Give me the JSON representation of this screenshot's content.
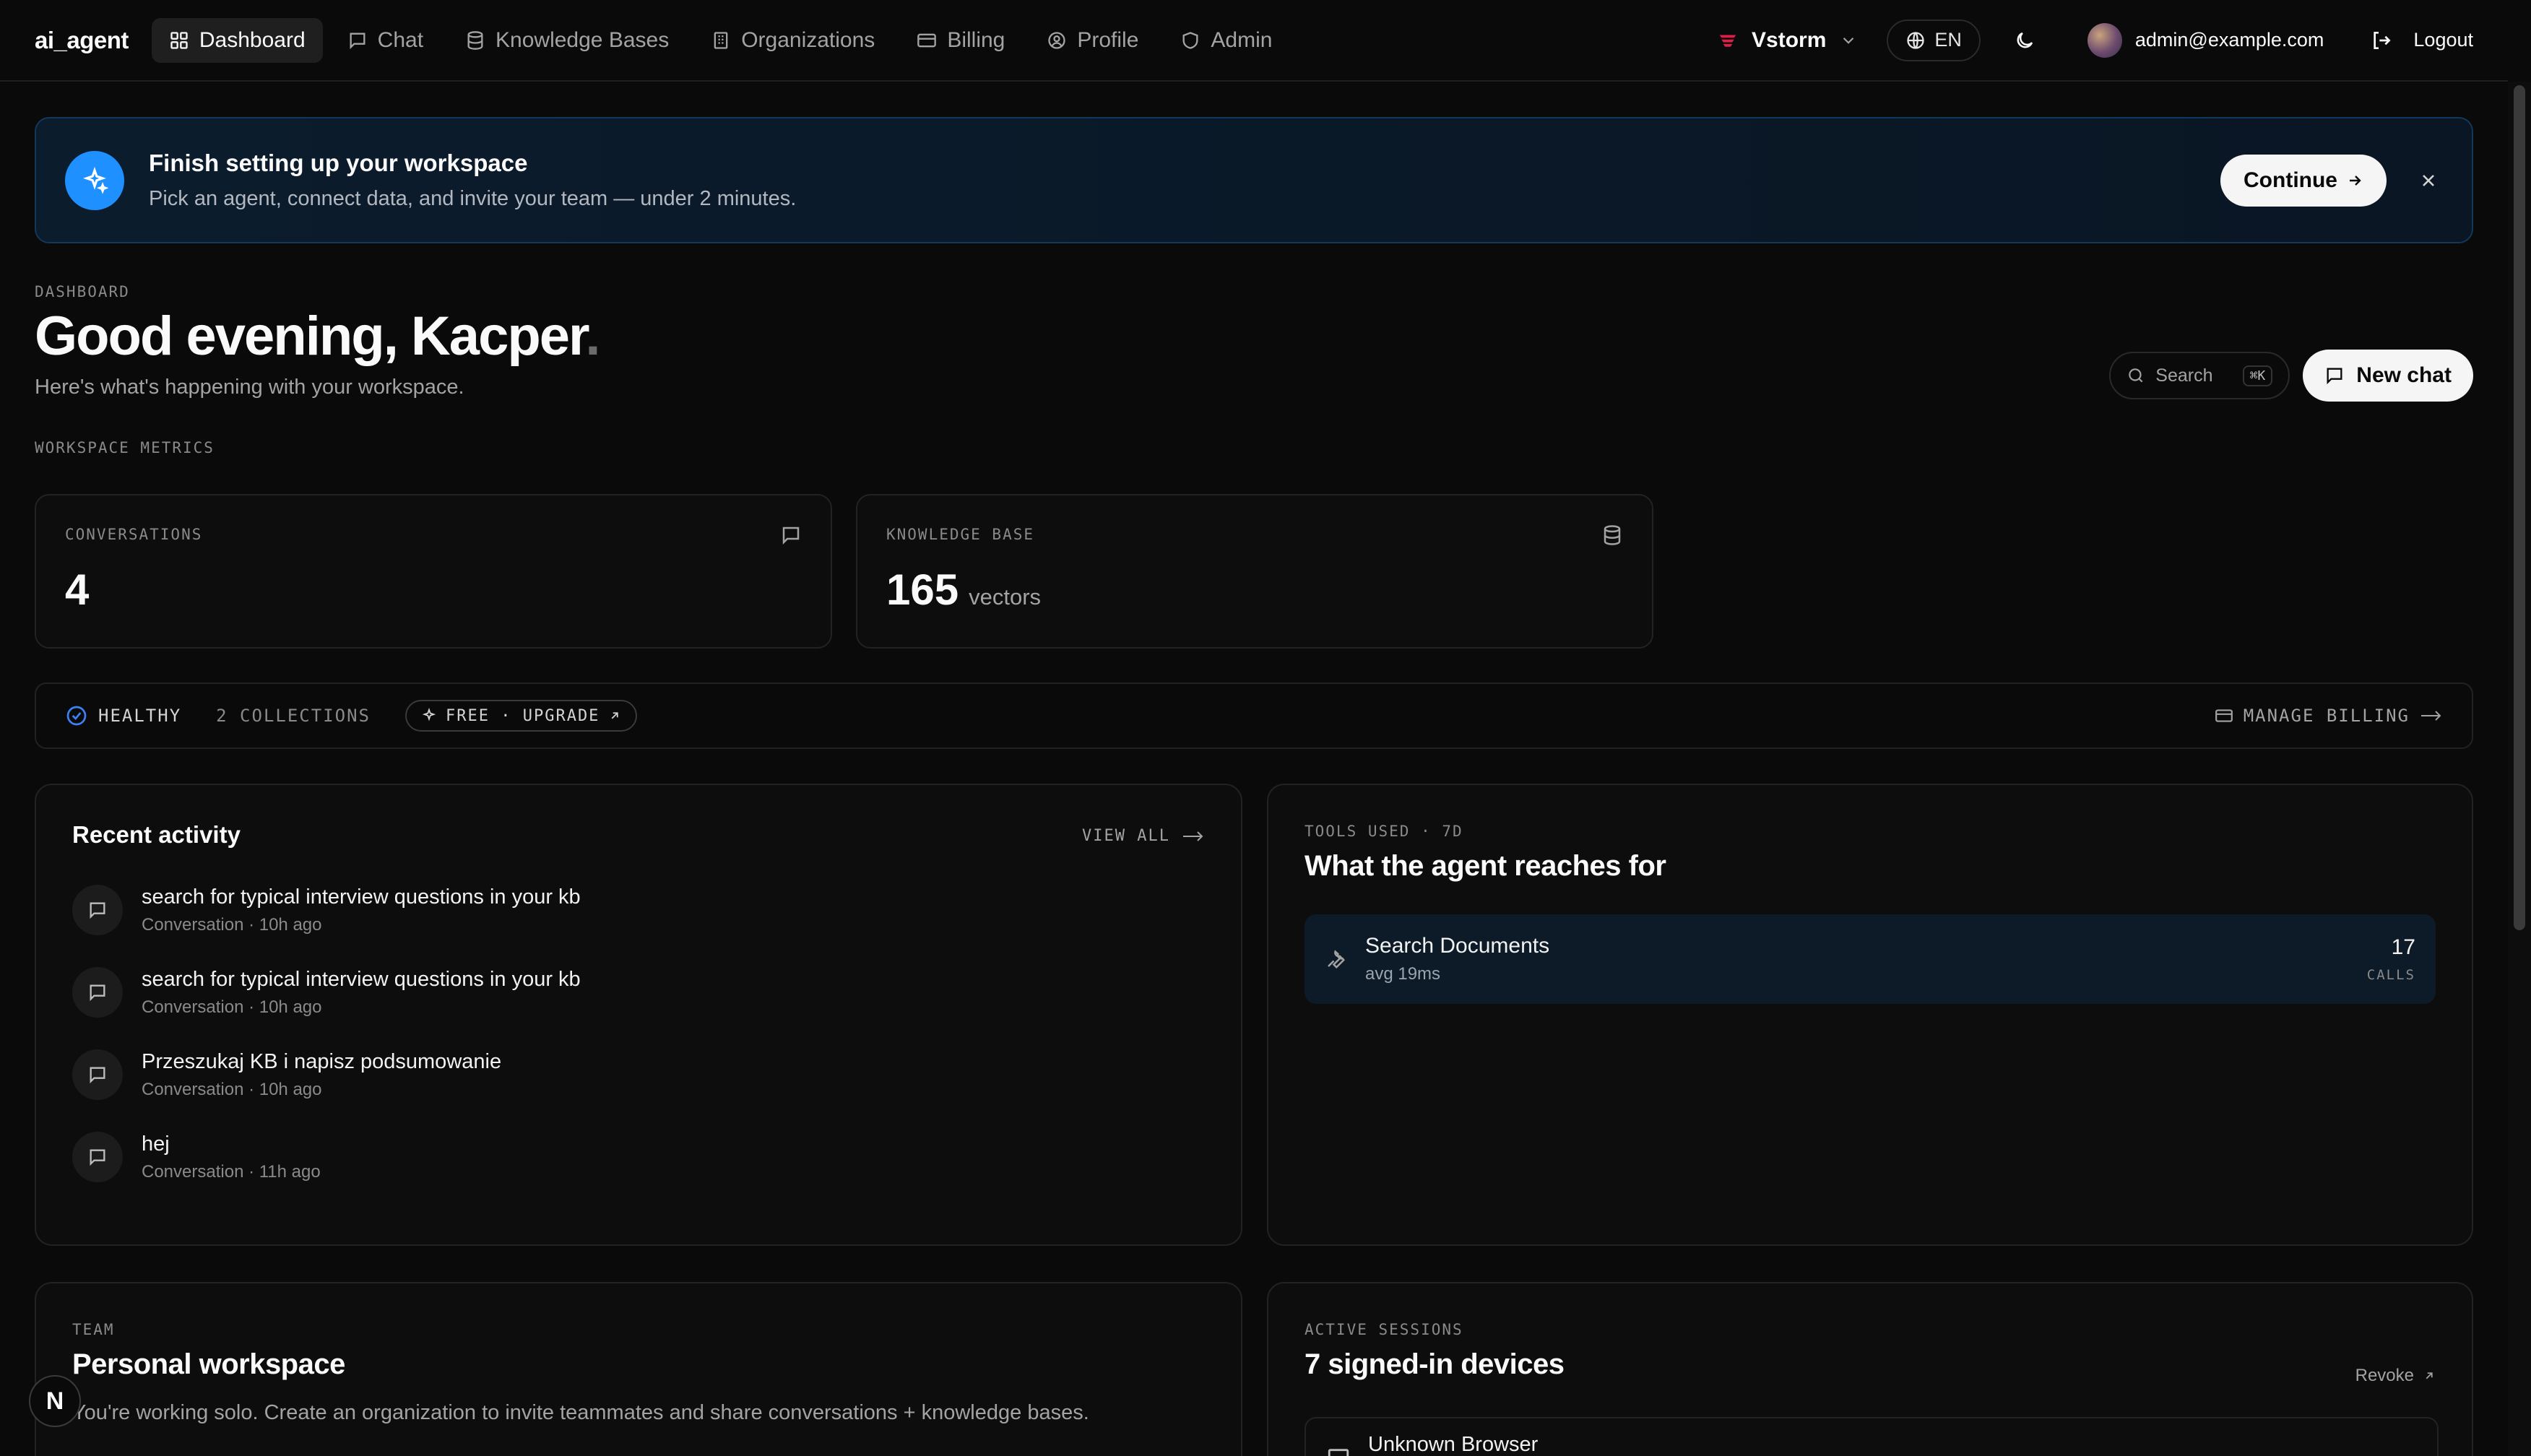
{
  "nav": {
    "brand": "ai_agent",
    "items": [
      {
        "label": "Dashboard",
        "icon": "grid-icon",
        "active": true
      },
      {
        "label": "Chat",
        "icon": "message-icon"
      },
      {
        "label": "Knowledge Bases",
        "icon": "database-icon"
      },
      {
        "label": "Organizations",
        "icon": "building-icon"
      },
      {
        "label": "Billing",
        "icon": "credit-card-icon"
      },
      {
        "label": "Profile",
        "icon": "user-circle-icon"
      },
      {
        "label": "Admin",
        "icon": "shield-icon"
      }
    ],
    "org": "Vstorm",
    "language": "EN",
    "user_email": "admin@example.com",
    "logout_label": "Logout"
  },
  "banner": {
    "title": "Finish setting up your workspace",
    "subtitle": "Pick an agent, connect data, and invite your team — under 2 minutes.",
    "continue_label": "Continue"
  },
  "header": {
    "eyebrow": "DASHBOARD",
    "greeting": "Good evening, Kacper",
    "greeting_dot": ".",
    "subtitle": "Here's what's happening with your workspace.",
    "search_label": "Search",
    "search_shortcut": "⌘K",
    "new_chat_label": "New chat"
  },
  "metrics": {
    "section_label": "WORKSPACE METRICS",
    "conversations": {
      "label": "CONVERSATIONS",
      "value": "4"
    },
    "knowledge_base": {
      "label": "KNOWLEDGE BASE",
      "value": "165",
      "unit": "vectors"
    }
  },
  "status": {
    "health": "HEALTHY",
    "collections": "2 COLLECTIONS",
    "plan": "FREE · UPGRADE",
    "manage_billing": "MANAGE BILLING"
  },
  "activity": {
    "title": "Recent activity",
    "view_all": "VIEW ALL",
    "items": [
      {
        "title": "search for typical interview questions in your kb",
        "meta": "Conversation · 10h ago"
      },
      {
        "title": "search for typical interview questions in your kb",
        "meta": "Conversation · 10h ago"
      },
      {
        "title": "Przeszukaj KB i napisz podsumowanie",
        "meta": "Conversation · 10h ago"
      },
      {
        "title": "hej",
        "meta": "Conversation · 11h ago"
      }
    ]
  },
  "tools": {
    "eyebrow": "TOOLS USED · 7D",
    "title": "What the agent reaches for",
    "items": [
      {
        "name": "Search Documents",
        "avg": "avg 19ms",
        "count": "17",
        "unit": "CALLS"
      }
    ]
  },
  "team": {
    "eyebrow": "TEAM",
    "title": "Personal workspace",
    "description": "You're working solo. Create an organization to invite teammates and share conversations + knowledge bases."
  },
  "sessions": {
    "eyebrow": "ACTIVE SESSIONS",
    "title": "7 signed-in devices",
    "revoke_label": "Revoke",
    "first_device": "Unknown Browser"
  },
  "floating_badge": "N",
  "colors": {
    "background": "#0a0a0a",
    "accent": "#1e90ff",
    "banner_border": "#12385a",
    "org_logo": "#e11d48"
  }
}
